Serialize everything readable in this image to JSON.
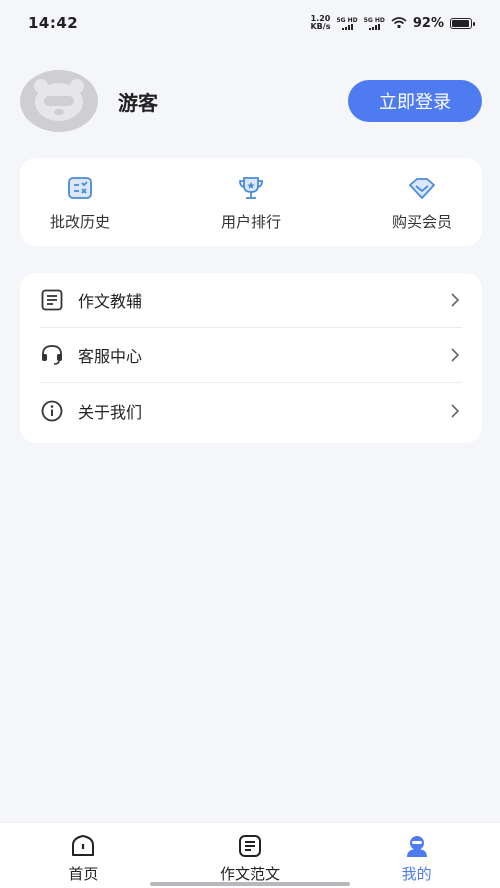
{
  "status": {
    "time": "14:42",
    "net_speed_value": "1.20",
    "net_speed_unit": "KB/s",
    "sim1": "5G HD",
    "sim2": "5G HD",
    "battery": "92%"
  },
  "profile": {
    "username": "游客",
    "login_label": "立即登录"
  },
  "quick_actions": [
    {
      "label": "批改历史",
      "icon": "correction-history-icon"
    },
    {
      "label": "用户排行",
      "icon": "trophy-icon"
    },
    {
      "label": "购买会员",
      "icon": "diamond-icon"
    }
  ],
  "menu": [
    {
      "label": "作文教辅",
      "icon": "document-icon"
    },
    {
      "label": "客服中心",
      "icon": "headset-icon"
    },
    {
      "label": "关于我们",
      "icon": "info-icon"
    }
  ],
  "tabs": [
    {
      "label": "首页",
      "icon": "home-icon",
      "active": false
    },
    {
      "label": "作文范文",
      "icon": "essay-icon",
      "active": false
    },
    {
      "label": "我的",
      "icon": "profile-icon",
      "active": true
    }
  ],
  "colors": {
    "accent": "#4f7bf1",
    "background": "#f5f6fa"
  }
}
